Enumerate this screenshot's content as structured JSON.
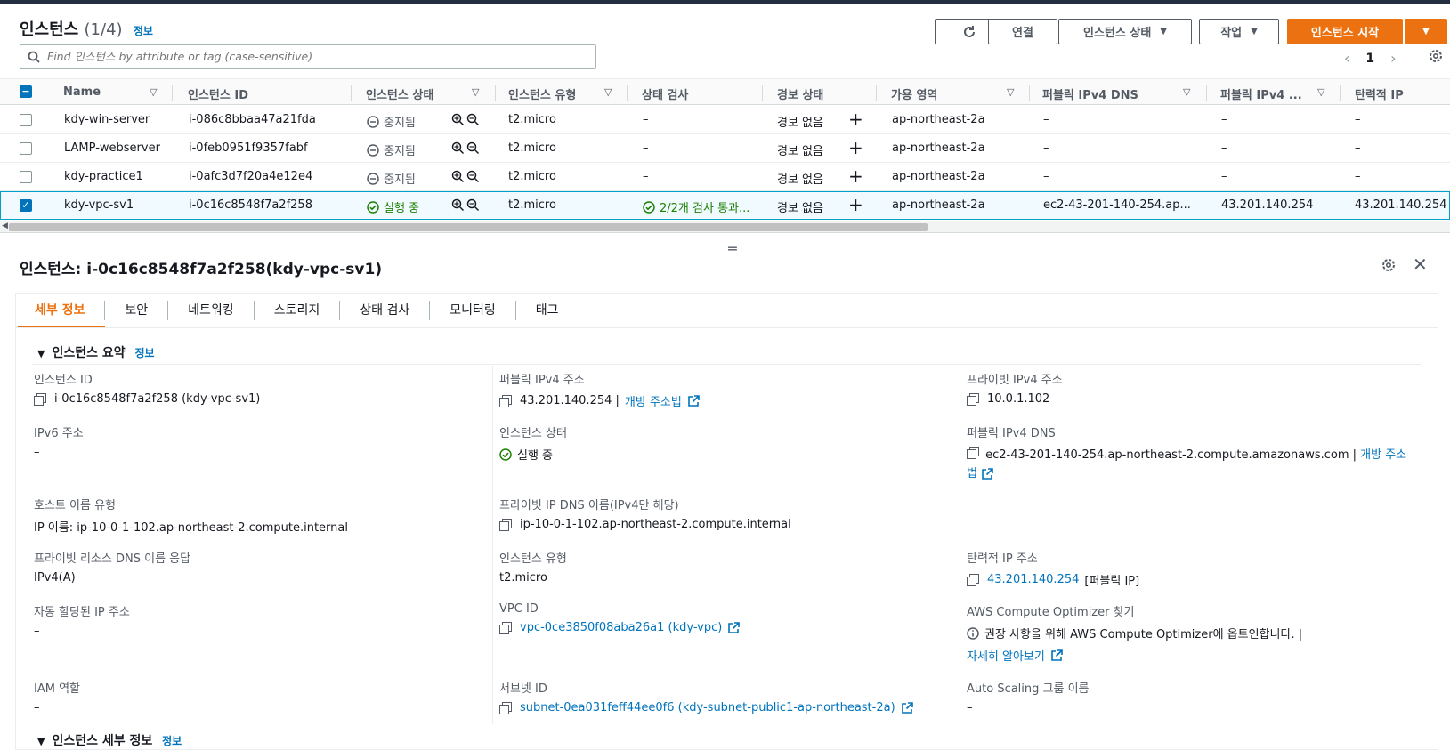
{
  "header": {
    "title": "인스턴스",
    "count": "(1/4)",
    "info": "정보",
    "connect": "연결",
    "instance_state": "인스턴스 상태",
    "actions": "작업",
    "launch": "인스턴스 시작"
  },
  "search": {
    "placeholder": "Find 인스턴스 by attribute or tag (case-sensitive)"
  },
  "pager": {
    "page": "1"
  },
  "table": {
    "columns": [
      "Name",
      "인스턴스 ID",
      "인스턴스 상태",
      "인스턴스 유형",
      "상태 검사",
      "경보 상태",
      "가용 영역",
      "퍼블릭 IPv4 DNS",
      "퍼블릭 IPv4 ...",
      "탄력적 IP"
    ],
    "rows": [
      {
        "name": "kdy-win-server",
        "id": "i-086c8bbaa47a21fda",
        "state": "중지됨",
        "type": "t2.micro",
        "check": "–",
        "alarm": "경보 없음",
        "az": "ap-northeast-2a",
        "dns": "–",
        "ipv4": "–",
        "eip": "–"
      },
      {
        "name": "LAMP-webserver",
        "id": "i-0feb0951f9357fabf",
        "state": "중지됨",
        "type": "t2.micro",
        "check": "–",
        "alarm": "경보 없음",
        "az": "ap-northeast-2a",
        "dns": "–",
        "ipv4": "–",
        "eip": "–"
      },
      {
        "name": "kdy-practice1",
        "id": "i-0afc3d7f20a4e12e4",
        "state": "중지됨",
        "type": "t2.micro",
        "check": "–",
        "alarm": "경보 없음",
        "az": "ap-northeast-2a",
        "dns": "–",
        "ipv4": "–",
        "eip": "–"
      },
      {
        "name": "kdy-vpc-sv1",
        "id": "i-0c16c8548f7a2f258",
        "state": "실행 중",
        "type": "t2.micro",
        "check": "2/2개 검사 통과...",
        "alarm": "경보 없음",
        "az": "ap-northeast-2a",
        "dns": "ec2-43-201-140-254.ap...",
        "ipv4": "43.201.140.254",
        "eip": "43.201.140.254"
      }
    ]
  },
  "detail": {
    "title": "인스턴스: i-0c16c8548f7a2f258(kdy-vpc-sv1)",
    "tabs": [
      "세부 정보",
      "보안",
      "네트워킹",
      "스토리지",
      "상태 검사",
      "모니터링",
      "태그"
    ],
    "summary_title": "인스턴스 요약",
    "summary_info": "정보",
    "details_title": "인스턴스 세부 정보",
    "details_info": "정보",
    "fields": {
      "instance_id_label": "인스턴스 ID",
      "instance_id_value": "i-0c16c8548f7a2f258 (kdy-vpc-sv1)",
      "public_ipv4_label": "퍼블릭 IPv4 주소",
      "public_ipv4_value": "43.201.140.254 |",
      "open_address": "개방 주소법",
      "private_ipv4_label": "프라이빗 IPv4 주소",
      "private_ipv4_value": "10.0.1.102",
      "ipv6_label": "IPv6 주소",
      "ipv6_value": "–",
      "state_label": "인스턴스 상태",
      "state_value": "실행 중",
      "public_dns_label": "퍼블릭 IPv4 DNS",
      "public_dns_value": "ec2-43-201-140-254.ap-northeast-2.compute.amazonaws.com |",
      "public_dns_open_1": "개방 주소",
      "public_dns_open_2": "법",
      "hostname_type_label": "호스트 이름 유형",
      "hostname_type_value": "IP 이름: ip-10-0-1-102.ap-northeast-2.compute.internal",
      "private_dns_label": "프라이빗 IP DNS 이름(IPv4만 해당)",
      "private_dns_value": "ip-10-0-1-102.ap-northeast-2.compute.internal",
      "resource_dns_label": "프라이빗 리소스 DNS 이름 응답",
      "resource_dns_value": "IPv4(A)",
      "instance_type_label": "인스턴스 유형",
      "instance_type_value": "t2.micro",
      "eip_label": "탄력적 IP 주소",
      "eip_value": "43.201.140.254",
      "eip_suffix": "[퍼블릭 IP]",
      "auto_ip_label": "자동 할당된 IP 주소",
      "auto_ip_value": "–",
      "vpc_label": "VPC ID",
      "vpc_value": "vpc-0ce3850f08aba26a1 (kdy-vpc)",
      "optimizer_label": "AWS Compute Optimizer 찾기",
      "optimizer_value": "권장 사항을 위해 AWS Compute Optimizer에 옵트인합니다. |",
      "optimizer_link": "자세히 알아보기",
      "iam_label": "IAM 역할",
      "iam_value": "–",
      "subnet_label": "서브넷 ID",
      "subnet_value": "subnet-0ea031feff44ee0f6 (kdy-subnet-public1-ap-northeast-2a)",
      "asg_label": "Auto Scaling 그룹 이름",
      "asg_value": "–"
    }
  },
  "colors": {
    "accent": "#ec7211",
    "link": "#0073bb",
    "running": "#1d8102"
  }
}
